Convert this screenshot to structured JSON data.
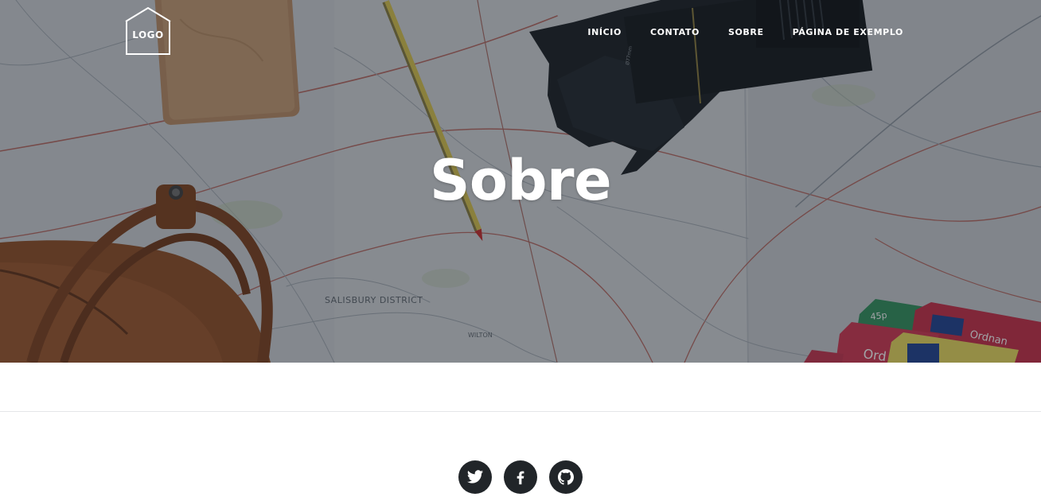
{
  "brand": {
    "logo_text": "LOGO"
  },
  "nav": {
    "items": [
      {
        "label": "INÍCIO"
      },
      {
        "label": "CONTATO"
      },
      {
        "label": "SOBRE"
      },
      {
        "label": "PÁGINA DE EXEMPLO"
      }
    ]
  },
  "hero": {
    "title": "Sobre",
    "overlay_color": "#1e242c",
    "map_label": "SALISBURY DISTRICT",
    "map_label_2": "WILTON",
    "map_tag": "45p",
    "map_brand": "Ordnan",
    "map_brand_2": "Ord"
  },
  "footer": {
    "social": [
      {
        "name": "twitter",
        "icon": "twitter-icon"
      },
      {
        "name": "facebook",
        "icon": "facebook-icon"
      },
      {
        "name": "github",
        "icon": "github-icon"
      }
    ]
  },
  "colors": {
    "social_bg": "#212529",
    "divider": "#e4e6e8"
  }
}
